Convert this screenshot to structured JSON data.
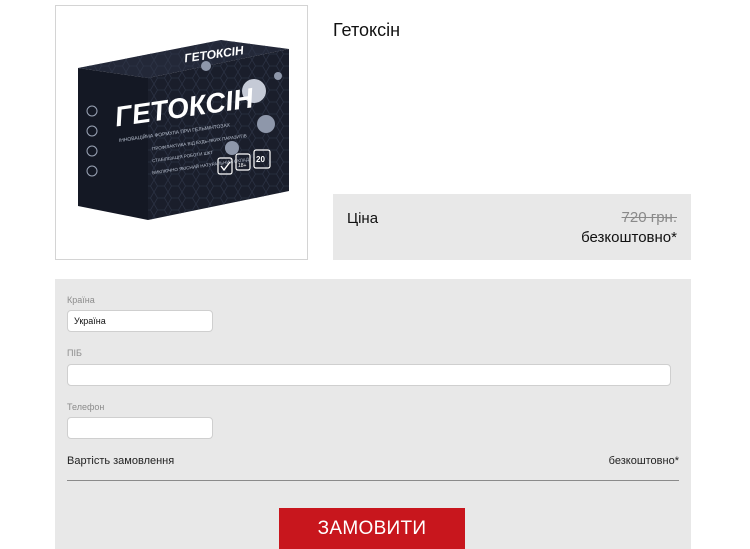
{
  "product": {
    "title": "Гетоксін",
    "box": {
      "brand": "ГЕТОКСІН",
      "subtitle": "ІННОВАЦІЙНА ФОРМУЛА ПРИ ГЕЛЬМІНТОЗАХ",
      "bullets": [
        "ПРОФІЛАКТИКА ВІД БУДЬ-ЯКИХ ПАРАЗИТІВ",
        "СТАБІЛІЗАЦІЯ РОБОТИ ШКТ",
        "ВИКЛЮЧНО ЯКІСНИЙ НАТУРАЛЬНИЙ СКЛАД"
      ],
      "age": "18+",
      "count": "20",
      "top_label": "ГЕТОКСІН"
    }
  },
  "price": {
    "label": "Ціна",
    "old": "720 грн.",
    "new": "безкоштовно*"
  },
  "form": {
    "country_label": "Країна",
    "country_value": "Україна",
    "name_label": "ПІБ",
    "name_value": "",
    "phone_label": "Телефон",
    "phone_value": "",
    "total_label": "Вартість замовлення",
    "total_value": "безкоштовно*",
    "submit_label": "ЗАМОВИТИ"
  },
  "colors": {
    "accent": "#c8161d",
    "panel": "#e8e8e8",
    "box_dark": "#1a1e2b"
  }
}
